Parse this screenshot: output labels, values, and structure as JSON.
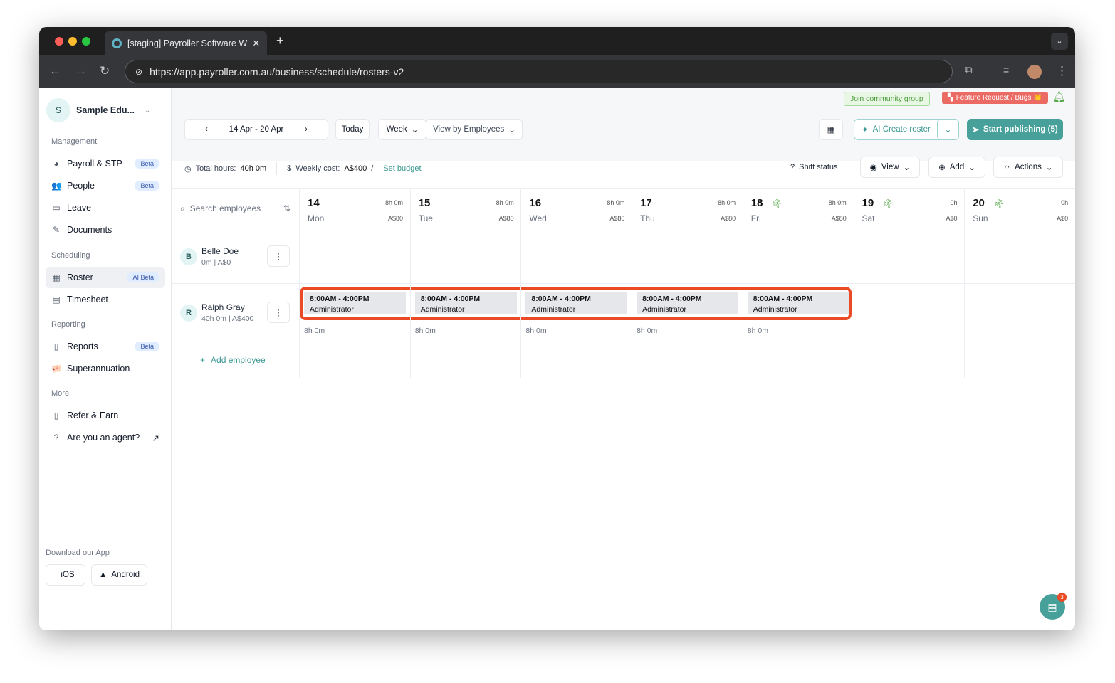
{
  "browser": {
    "tab_title": "[staging] Payroller Software W",
    "url": "https://app.payroller.com.au/business/schedule/rosters-v2"
  },
  "sidebar": {
    "org_initial": "S",
    "org_name": "Sample Edu...",
    "sections": {
      "management": "Management",
      "scheduling": "Scheduling",
      "reporting": "Reporting",
      "more": "More"
    },
    "items": [
      {
        "label": "Payroll & STP",
        "badge": "Beta",
        "icon": "payroll-icon"
      },
      {
        "label": "People",
        "badge": "Beta",
        "icon": "people-icon"
      },
      {
        "label": "Leave",
        "icon": "leave-icon"
      },
      {
        "label": "Documents",
        "icon": "documents-icon"
      },
      {
        "label": "Roster",
        "badge": "AI Beta",
        "icon": "calendar-icon",
        "active": true
      },
      {
        "label": "Timesheet",
        "icon": "timesheet-icon"
      },
      {
        "label": "Reports",
        "badge": "Beta",
        "icon": "reports-icon"
      },
      {
        "label": "Superannuation",
        "icon": "piggy-icon"
      },
      {
        "label": "Refer & Earn",
        "icon": "refer-icon"
      },
      {
        "label": "Are you an agent?",
        "icon": "help-icon"
      }
    ],
    "download_label": "Download our App",
    "ios": "iOS",
    "android": "Android"
  },
  "topbar": {
    "community": "Join community group",
    "feature": "Feature Request / Bugs 👏"
  },
  "toolbar": {
    "date_range": "14 Apr - 20 Apr",
    "today": "Today",
    "period": "Week",
    "view_by": "View by Employees",
    "ai_create": "AI Create roster",
    "publish": "Start publishing (5)"
  },
  "summary": {
    "total_hours_label": "Total hours:",
    "total_hours": "40h 0m",
    "weekly_cost_label": "Weekly cost:",
    "weekly_cost": "A$400",
    "set_budget": "Set budget",
    "shift_status": "Shift status",
    "view": "View",
    "add": "Add",
    "actions": "Actions"
  },
  "search_placeholder": "Search employees",
  "days": [
    {
      "num": "14",
      "name": "Mon",
      "hours": "8h 0m",
      "cost": "A$80"
    },
    {
      "num": "15",
      "name": "Tue",
      "hours": "8h 0m",
      "cost": "A$80"
    },
    {
      "num": "16",
      "name": "Wed",
      "hours": "8h 0m",
      "cost": "A$80"
    },
    {
      "num": "17",
      "name": "Thu",
      "hours": "8h 0m",
      "cost": "A$80"
    },
    {
      "num": "18",
      "name": "Fri",
      "hours": "8h 0m",
      "cost": "A$80",
      "holiday": true
    },
    {
      "num": "19",
      "name": "Sat",
      "hours": "0h",
      "cost": "A$0",
      "holiday": true
    },
    {
      "num": "20",
      "name": "Sun",
      "hours": "0h",
      "cost": "A$0",
      "holiday": true
    }
  ],
  "employees": [
    {
      "initial": "B",
      "name": "Belle Doe",
      "summary": "0m | A$0"
    },
    {
      "initial": "R",
      "name": "Ralph Gray",
      "summary": "40h 0m | A$400"
    }
  ],
  "shifts": [
    {
      "time": "8:00AM - 4:00PM",
      "role": "Administrator",
      "total": "8h 0m"
    },
    {
      "time": "8:00AM - 4:00PM",
      "role": "Administrator",
      "total": "8h 0m"
    },
    {
      "time": "8:00AM - 4:00PM",
      "role": "Administrator",
      "total": "8h 0m"
    },
    {
      "time": "8:00AM - 4:00PM",
      "role": "Administrator",
      "total": "8h 0m"
    },
    {
      "time": "8:00AM - 4:00PM",
      "role": "Administrator",
      "total": "8h 0m"
    }
  ],
  "add_employee": "Add employee",
  "chat_badge": "3"
}
